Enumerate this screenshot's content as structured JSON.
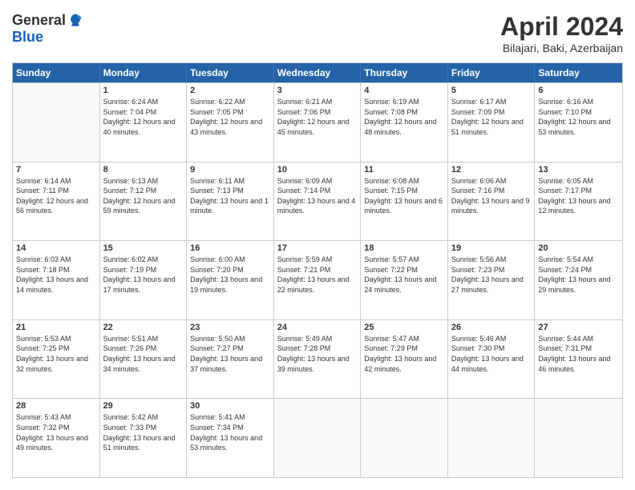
{
  "logo": {
    "general": "General",
    "blue": "Blue"
  },
  "title": "April 2024",
  "location": "Bilajari, Baki, Azerbaijan",
  "days": [
    "Sunday",
    "Monday",
    "Tuesday",
    "Wednesday",
    "Thursday",
    "Friday",
    "Saturday"
  ],
  "weeks": [
    [
      {
        "day": "",
        "empty": true
      },
      {
        "day": "1",
        "sunrise": "6:24 AM",
        "sunset": "7:04 PM",
        "daylight": "12 hours and 40 minutes."
      },
      {
        "day": "2",
        "sunrise": "6:22 AM",
        "sunset": "7:05 PM",
        "daylight": "12 hours and 43 minutes."
      },
      {
        "day": "3",
        "sunrise": "6:21 AM",
        "sunset": "7:06 PM",
        "daylight": "12 hours and 45 minutes."
      },
      {
        "day": "4",
        "sunrise": "6:19 AM",
        "sunset": "7:08 PM",
        "daylight": "12 hours and 48 minutes."
      },
      {
        "day": "5",
        "sunrise": "6:17 AM",
        "sunset": "7:09 PM",
        "daylight": "12 hours and 51 minutes."
      },
      {
        "day": "6",
        "sunrise": "6:16 AM",
        "sunset": "7:10 PM",
        "daylight": "12 hours and 53 minutes."
      }
    ],
    [
      {
        "day": "7",
        "sunrise": "6:14 AM",
        "sunset": "7:11 PM",
        "daylight": "12 hours and 56 minutes."
      },
      {
        "day": "8",
        "sunrise": "6:13 AM",
        "sunset": "7:12 PM",
        "daylight": "12 hours and 59 minutes."
      },
      {
        "day": "9",
        "sunrise": "6:11 AM",
        "sunset": "7:13 PM",
        "daylight": "13 hours and 1 minute."
      },
      {
        "day": "10",
        "sunrise": "6:09 AM",
        "sunset": "7:14 PM",
        "daylight": "13 hours and 4 minutes."
      },
      {
        "day": "11",
        "sunrise": "6:08 AM",
        "sunset": "7:15 PM",
        "daylight": "13 hours and 6 minutes."
      },
      {
        "day": "12",
        "sunrise": "6:06 AM",
        "sunset": "7:16 PM",
        "daylight": "13 hours and 9 minutes."
      },
      {
        "day": "13",
        "sunrise": "6:05 AM",
        "sunset": "7:17 PM",
        "daylight": "13 hours and 12 minutes."
      }
    ],
    [
      {
        "day": "14",
        "sunrise": "6:03 AM",
        "sunset": "7:18 PM",
        "daylight": "13 hours and 14 minutes."
      },
      {
        "day": "15",
        "sunrise": "6:02 AM",
        "sunset": "7:19 PM",
        "daylight": "13 hours and 17 minutes."
      },
      {
        "day": "16",
        "sunrise": "6:00 AM",
        "sunset": "7:20 PM",
        "daylight": "13 hours and 19 minutes."
      },
      {
        "day": "17",
        "sunrise": "5:59 AM",
        "sunset": "7:21 PM",
        "daylight": "13 hours and 22 minutes."
      },
      {
        "day": "18",
        "sunrise": "5:57 AM",
        "sunset": "7:22 PM",
        "daylight": "13 hours and 24 minutes."
      },
      {
        "day": "19",
        "sunrise": "5:56 AM",
        "sunset": "7:23 PM",
        "daylight": "13 hours and 27 minutes."
      },
      {
        "day": "20",
        "sunrise": "5:54 AM",
        "sunset": "7:24 PM",
        "daylight": "13 hours and 29 minutes."
      }
    ],
    [
      {
        "day": "21",
        "sunrise": "5:53 AM",
        "sunset": "7:25 PM",
        "daylight": "13 hours and 32 minutes."
      },
      {
        "day": "22",
        "sunrise": "5:51 AM",
        "sunset": "7:26 PM",
        "daylight": "13 hours and 34 minutes."
      },
      {
        "day": "23",
        "sunrise": "5:50 AM",
        "sunset": "7:27 PM",
        "daylight": "13 hours and 37 minutes."
      },
      {
        "day": "24",
        "sunrise": "5:49 AM",
        "sunset": "7:28 PM",
        "daylight": "13 hours and 39 minutes."
      },
      {
        "day": "25",
        "sunrise": "5:47 AM",
        "sunset": "7:29 PM",
        "daylight": "13 hours and 42 minutes."
      },
      {
        "day": "26",
        "sunrise": "5:46 AM",
        "sunset": "7:30 PM",
        "daylight": "13 hours and 44 minutes."
      },
      {
        "day": "27",
        "sunrise": "5:44 AM",
        "sunset": "7:31 PM",
        "daylight": "13 hours and 46 minutes."
      }
    ],
    [
      {
        "day": "28",
        "sunrise": "5:43 AM",
        "sunset": "7:32 PM",
        "daylight": "13 hours and 49 minutes."
      },
      {
        "day": "29",
        "sunrise": "5:42 AM",
        "sunset": "7:33 PM",
        "daylight": "13 hours and 51 minutes."
      },
      {
        "day": "30",
        "sunrise": "5:41 AM",
        "sunset": "7:34 PM",
        "daylight": "13 hours and 53 minutes."
      },
      {
        "day": "",
        "empty": true
      },
      {
        "day": "",
        "empty": true
      },
      {
        "day": "",
        "empty": true
      },
      {
        "day": "",
        "empty": true
      }
    ]
  ]
}
